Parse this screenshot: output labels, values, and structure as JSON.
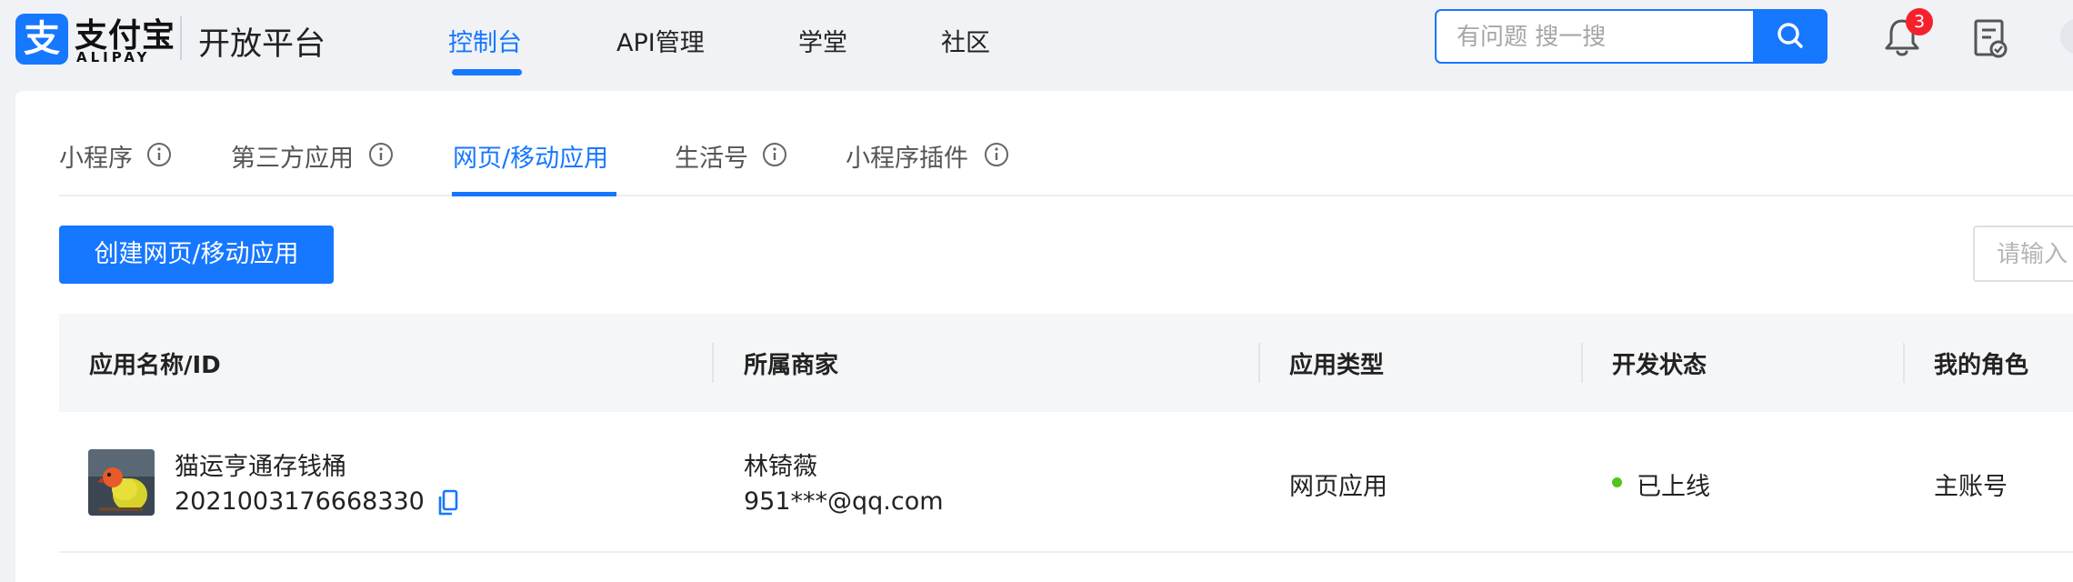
{
  "header": {
    "logo_mark": "支",
    "logo_cn": "支付宝",
    "logo_en": "ALIPAY",
    "platform_title": "开放平台",
    "nav": [
      {
        "label": "控制台",
        "active": true
      },
      {
        "label": "API管理",
        "active": false
      },
      {
        "label": "学堂",
        "active": false
      },
      {
        "label": "社区",
        "active": false
      }
    ],
    "search": {
      "placeholder": "有问题 搜一搜",
      "value": ""
    },
    "notification_count": "3",
    "icons": [
      "search-icon",
      "bell-icon",
      "todo-list-icon"
    ]
  },
  "tabs": [
    {
      "label": "小程序",
      "info": true,
      "active": false
    },
    {
      "label": "第三方应用",
      "info": true,
      "active": false
    },
    {
      "label": "网页/移动应用",
      "info": false,
      "active": true
    },
    {
      "label": "生活号",
      "info": true,
      "active": false
    },
    {
      "label": "小程序插件",
      "info": true,
      "active": false
    }
  ],
  "toolbar": {
    "create_label": "创建网页/移动应用",
    "search_placeholder": "请输入"
  },
  "table": {
    "columns": [
      "应用名称/ID",
      "所属商家",
      "应用类型",
      "开发状态",
      "我的角色"
    ],
    "rows": [
      {
        "app_name": "猫运亨通存钱桶",
        "app_id": "2021003176668330",
        "merchant_name": "林锜薇",
        "merchant_account": "951***@qq.com",
        "app_type": "网页应用",
        "status": "已上线",
        "role": "主账号"
      }
    ]
  },
  "colors": {
    "primary": "#1677ff",
    "status_online": "#52c41a",
    "badge": "#f5222d"
  }
}
